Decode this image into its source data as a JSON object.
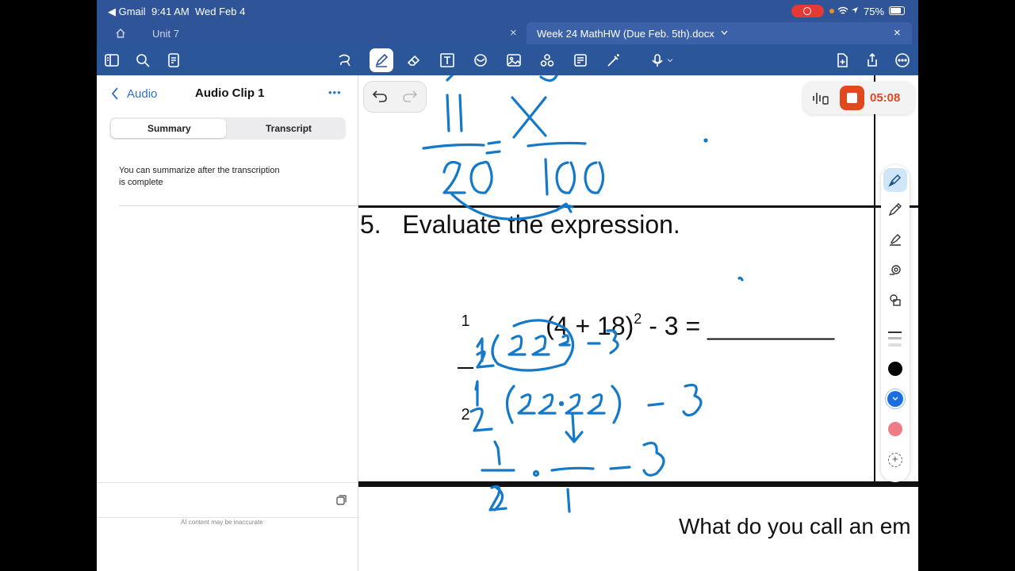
{
  "status": {
    "back_app": "◀ Gmail",
    "time": "9:41 AM",
    "date": "Wed Feb 4",
    "battery": "75%"
  },
  "tabs": {
    "inactive": "Unit 7",
    "active": "Week 24 MathHW (Due Feb. 5th).docx"
  },
  "sidebar": {
    "back_label": "Audio",
    "title": "Audio Clip 1",
    "more": "•••",
    "seg_summary": "Summary",
    "seg_transcript": "Transcript",
    "summary_text_line1": "You can summarize after the transcription",
    "summary_text_line2": "is complete",
    "disclaimer": "AI content may be inaccurate"
  },
  "recording": {
    "timer": "05:08"
  },
  "document": {
    "question": "5.   Evaluate the expression.",
    "frac_num": "1",
    "frac_den": "2",
    "expr_main": "(4 + 18)",
    "expr_exp": "2",
    "expr_tail": " - 3 = _________",
    "footer_text": "What do you call an em"
  },
  "colors": {
    "toolbar": "#2b579a",
    "ink": "#1479c9",
    "record": "#e0481f"
  }
}
